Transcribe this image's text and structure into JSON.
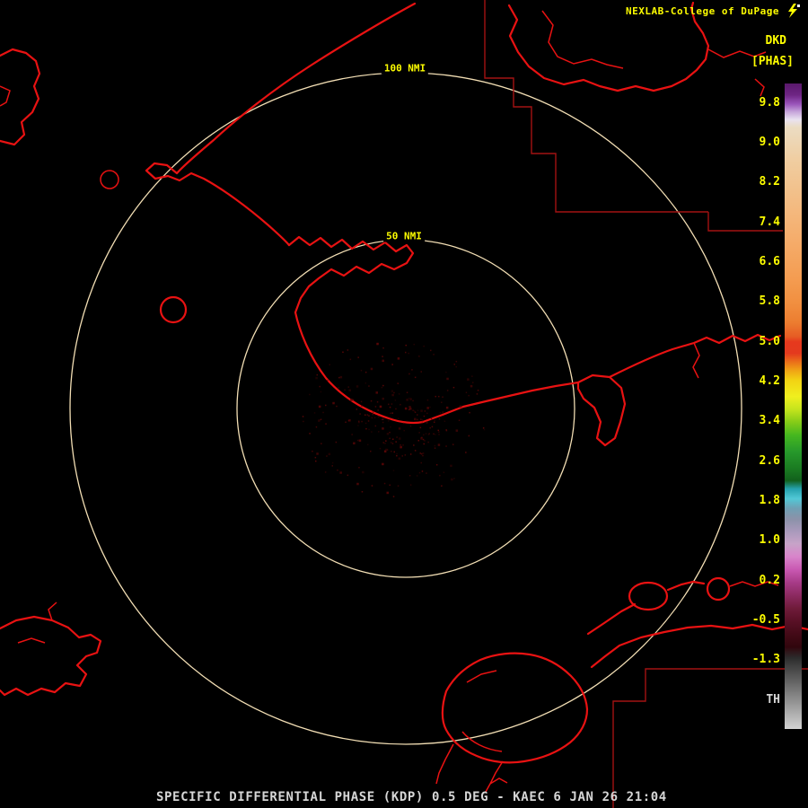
{
  "header": {
    "title": "NEXLAB-College of DuPage",
    "product_code": "DKD",
    "units": "[PHAS]",
    "logo_icon": "lightning-icon"
  },
  "rings": {
    "outer_label": "100 NMI",
    "inner_label": "50 NMI"
  },
  "colorbar": {
    "ticks": [
      "9.8",
      "9.0",
      "8.2",
      "7.4",
      "6.6",
      "5.8",
      "5.0",
      "4.2",
      "3.4",
      "2.6",
      "1.8",
      "1.0",
      "0.2",
      "-0.5",
      "-1.3"
    ],
    "threshold_label": "TH",
    "gradient": [
      {
        "pos": 0,
        "color": "#59196b"
      },
      {
        "pos": 1.8,
        "color": "#6f2585"
      },
      {
        "pos": 3.2,
        "color": "#9a55bb"
      },
      {
        "pos": 4.4,
        "color": "#c6a6db"
      },
      {
        "pos": 5.6,
        "color": "#e9e2f0"
      },
      {
        "pos": 6.8,
        "color": "#ebdcc2"
      },
      {
        "pos": 12,
        "color": "#f0cda0"
      },
      {
        "pos": 18,
        "color": "#f3bd85"
      },
      {
        "pos": 24,
        "color": "#f5ad6c"
      },
      {
        "pos": 30,
        "color": "#f49d52"
      },
      {
        "pos": 34,
        "color": "#f18f40"
      },
      {
        "pos": 37,
        "color": "#ec7d30"
      },
      {
        "pos": 39.2,
        "color": "#e65c24"
      },
      {
        "pos": 40,
        "color": "#e6391e"
      },
      {
        "pos": 41.8,
        "color": "#e43a1e"
      },
      {
        "pos": 43,
        "color": "#ea6a1a"
      },
      {
        "pos": 44.5,
        "color": "#f0a515"
      },
      {
        "pos": 46,
        "color": "#f2d313"
      },
      {
        "pos": 48.5,
        "color": "#f0ef1e"
      },
      {
        "pos": 50.5,
        "color": "#c4e41d"
      },
      {
        "pos": 52.5,
        "color": "#84cb18"
      },
      {
        "pos": 54.5,
        "color": "#45b71f"
      },
      {
        "pos": 57,
        "color": "#27992b"
      },
      {
        "pos": 59.5,
        "color": "#1b7d22"
      },
      {
        "pos": 61.5,
        "color": "#11601c"
      },
      {
        "pos": 62.8,
        "color": "#25a2ae"
      },
      {
        "pos": 64.3,
        "color": "#52c8d6"
      },
      {
        "pos": 65.8,
        "color": "#6fa0b4"
      },
      {
        "pos": 67.5,
        "color": "#8c92a9"
      },
      {
        "pos": 69.3,
        "color": "#a899bb"
      },
      {
        "pos": 71.3,
        "color": "#c7a3c8"
      },
      {
        "pos": 73.3,
        "color": "#d884ca"
      },
      {
        "pos": 75.3,
        "color": "#c958b2"
      },
      {
        "pos": 77.3,
        "color": "#a73b88"
      },
      {
        "pos": 79.3,
        "color": "#8c2a60"
      },
      {
        "pos": 81.3,
        "color": "#6f1b3a"
      },
      {
        "pos": 83.3,
        "color": "#591026"
      },
      {
        "pos": 85.3,
        "color": "#430a17"
      },
      {
        "pos": 87.3,
        "color": "#31060d"
      },
      {
        "pos": 89,
        "color": "#2c2c2c"
      },
      {
        "pos": 90,
        "color": "#3c3c3c"
      },
      {
        "pos": 100,
        "color": "#d2d2d2"
      }
    ]
  },
  "status_bar": {
    "text": "SPECIFIC DIFFERENTIAL PHASE (KDP) 0.5 DEG - KAEC 6 JAN 26 21:04"
  },
  "colors": {
    "background": "#000000",
    "map_outline": "#e81212",
    "county_line": "#a31212",
    "range_ring": "#f2deb4",
    "label_yellow": "#fdfd00",
    "status_text": "#d6d6d6",
    "echo": "#5a0606"
  }
}
